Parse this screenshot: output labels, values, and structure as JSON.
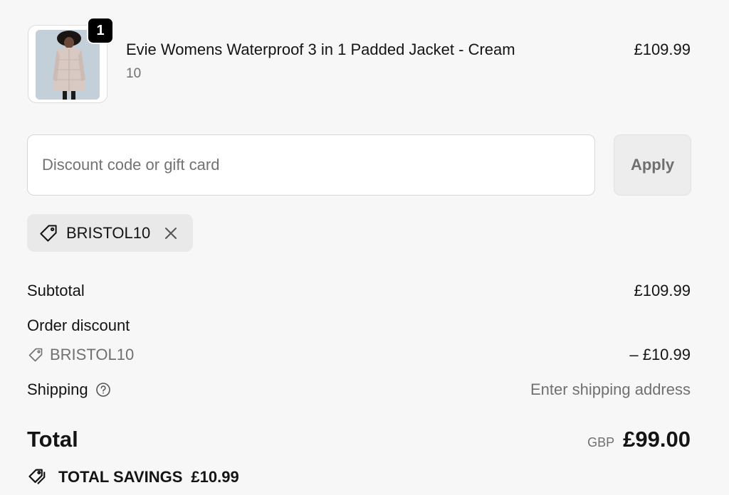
{
  "line_item": {
    "quantity": "1",
    "title": "Evie Womens Waterproof 3 in 1 Padded Jacket - Cream",
    "variant": "10",
    "price": "£109.99"
  },
  "discount": {
    "placeholder": "Discount code or gift card",
    "value": "",
    "apply_label": "Apply",
    "applied_code": "BRISTOL10"
  },
  "summary": {
    "subtotal_label": "Subtotal",
    "subtotal_value": "£109.99",
    "order_discount_label": "Order discount",
    "order_discount_code": "BRISTOL10",
    "order_discount_value": "– £10.99",
    "shipping_label": "Shipping",
    "shipping_value": "Enter shipping address",
    "total_label": "Total",
    "total_currency": "GBP",
    "total_amount": "£99.00",
    "savings_label": "TOTAL SAVINGS",
    "savings_amount": "£10.99"
  },
  "icons": {
    "tag": "tag-icon",
    "close": "close-icon",
    "help": "help-circle-icon",
    "savings": "savings-tags-icon"
  },
  "colors": {
    "background": "#f7f7f7",
    "badge": "#000000",
    "muted_text": "#707070",
    "chip_bg": "#e9e9e9"
  }
}
